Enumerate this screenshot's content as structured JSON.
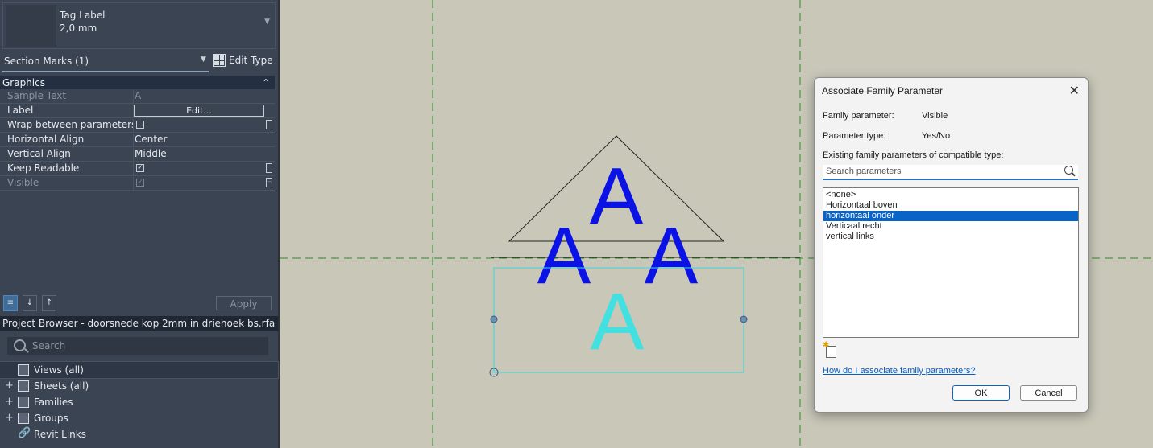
{
  "type_selector": {
    "line1": "Tag Label",
    "line2": "2,0 mm"
  },
  "section": {
    "selector_label": "Section Marks (1)",
    "edit_type_label": "Edit Type"
  },
  "properties": {
    "group_title": "Graphics",
    "rows": {
      "sample_text": {
        "name": "Sample Text",
        "value": "A"
      },
      "label": {
        "name": "Label",
        "value": "Edit..."
      },
      "wrap": {
        "name": "Wrap between parameters ..."
      },
      "halign": {
        "name": "Horizontal Align",
        "value": "Center"
      },
      "valign": {
        "name": "Vertical Align",
        "value": "Middle"
      },
      "keep_readable": {
        "name": "Keep Readable"
      },
      "visible": {
        "name": "Visible"
      }
    },
    "apply_label": "Apply"
  },
  "browser": {
    "title": "Project Browser - doorsnede kop 2mm in driehoek bs.rfa",
    "search_placeholder": "Search",
    "items": [
      "Views (all)",
      "Sheets (all)",
      "Families",
      "Groups",
      "Revit Links"
    ]
  },
  "canvas": {
    "glyph": "A"
  },
  "dialog": {
    "title": "Associate Family Parameter",
    "family_parameter_label": "Family parameter:",
    "family_parameter_value": "Visible",
    "parameter_type_label": "Parameter type:",
    "parameter_type_value": "Yes/No",
    "existing_label": "Existing family parameters of compatible type:",
    "search_placeholder": "Search parameters",
    "list": [
      "<none>",
      "Horizontaal boven",
      "horizontaal onder",
      "Verticaal recht",
      "vertical links"
    ],
    "selected_index": 2,
    "help_link": "How do I associate family parameters?",
    "ok_label": "OK",
    "cancel_label": "Cancel"
  }
}
